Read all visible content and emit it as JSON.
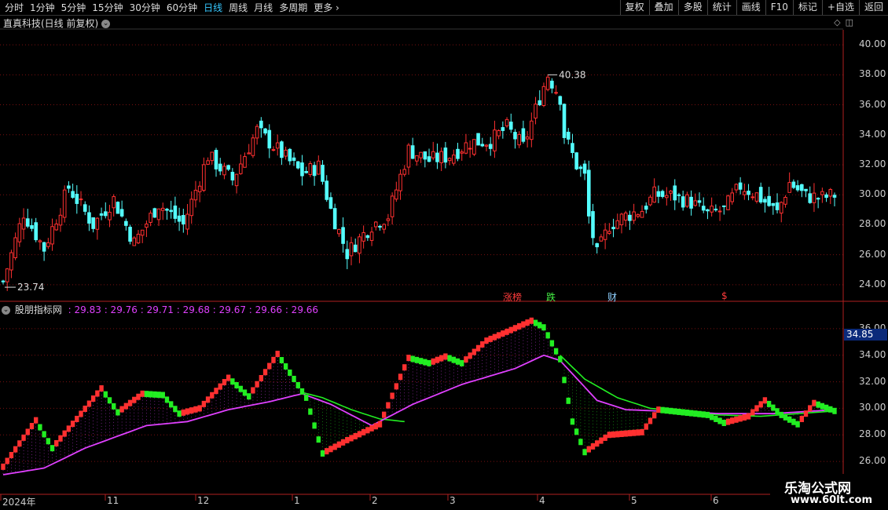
{
  "toolbar": {
    "tabs": [
      "分时",
      "1分钟",
      "5分钟",
      "15分钟",
      "30分钟",
      "60分钟",
      "日线",
      "周线",
      "月线",
      "多周期",
      "更多"
    ],
    "active": "日线",
    "right_buttons": [
      "复权",
      "叠加",
      "多股",
      "统计",
      "画线",
      "F10",
      "标记",
      "+自选",
      "返回"
    ]
  },
  "main": {
    "title": "直真科技(日线 前复权)",
    "max_label": "40.38",
    "min_label": "23.74",
    "y_ticks": [
      "40.00",
      "38.00",
      "36.00",
      "34.00",
      "32.00",
      "30.00",
      "28.00",
      "26.00",
      "24.00"
    ],
    "markers": [
      {
        "text": "涨榜",
        "color": "#ff3b3b"
      },
      {
        "text": "跌",
        "color": "#44ee44"
      },
      {
        "text": "财",
        "color": "#8fd0ff"
      },
      {
        "text": "$",
        "color": "#ff3b3b"
      }
    ]
  },
  "indicator": {
    "name": "股朋指标网",
    "values": ": 29.83 : 29.76 : 29.71 : 29.68 : 29.67 : 29.66 : 29.66",
    "y_ticks": [
      "36.00",
      "34.00",
      "32.00",
      "30.00",
      "28.00",
      "26.00"
    ],
    "current": "34.85"
  },
  "x_axis": [
    "2024年",
    "11",
    "12",
    "1",
    "2",
    "3",
    "4",
    "5",
    "6"
  ],
  "watermark": {
    "line1": "乐淘公式网",
    "line2": "www.60lt.com"
  },
  "colors": {
    "up": "#ff3030",
    "down": "#54ffff",
    "grid": "#7a1010",
    "axis": "#b02020",
    "green": "#22ee22",
    "magenta": "#e040ff"
  },
  "chart_data": {
    "type": "candlestick",
    "main_ylim": [
      23,
      41
    ],
    "indicator_ylim": [
      25,
      37
    ],
    "price_path": [
      [
        0,
        24.2
      ],
      [
        5,
        28.8
      ],
      [
        10,
        26.4
      ],
      [
        16,
        30.5
      ],
      [
        22,
        28.0
      ],
      [
        27,
        29.7
      ],
      [
        32,
        26.8
      ],
      [
        38,
        29.4
      ],
      [
        44,
        28.0
      ],
      [
        50,
        32.6
      ],
      [
        56,
        31.0
      ],
      [
        62,
        34.3
      ],
      [
        67,
        33.0
      ],
      [
        73,
        31.4
      ],
      [
        77,
        31.9
      ],
      [
        80,
        29.0
      ],
      [
        84,
        26.1
      ],
      [
        90,
        28.0
      ],
      [
        94,
        28.6
      ],
      [
        99,
        33.0
      ],
      [
        104,
        32.3
      ],
      [
        109,
        32.6
      ],
      [
        114,
        33.5
      ],
      [
        119,
        33.6
      ],
      [
        123,
        34.5
      ],
      [
        127,
        33.2
      ],
      [
        131,
        36.5
      ],
      [
        133,
        38.0
      ],
      [
        136,
        36.5
      ],
      [
        137,
        34.0
      ],
      [
        140,
        32.0
      ],
      [
        142,
        31.2
      ],
      [
        143,
        28.5
      ],
      [
        145,
        26.0
      ],
      [
        148,
        28.0
      ],
      [
        152,
        28.6
      ],
      [
        156,
        29.0
      ],
      [
        159,
        30.0
      ],
      [
        164,
        29.9
      ],
      [
        168,
        29.5
      ],
      [
        172,
        28.7
      ],
      [
        176,
        29.0
      ],
      [
        180,
        30.6
      ],
      [
        184,
        30.0
      ],
      [
        187,
        29.3
      ],
      [
        189,
        28.8
      ],
      [
        192,
        30.8
      ],
      [
        196,
        29.9
      ],
      [
        200,
        29.8
      ],
      [
        203,
        30.0
      ]
    ],
    "indicator_path": [
      [
        0,
        25.6
      ],
      [
        8,
        29.1
      ],
      [
        12,
        27.0
      ],
      [
        18,
        29.2
      ],
      [
        24,
        31.5
      ],
      [
        28,
        29.7
      ],
      [
        34,
        31.1
      ],
      [
        39,
        31.0
      ],
      [
        43,
        29.6
      ],
      [
        48,
        30.0
      ],
      [
        55,
        32.3
      ],
      [
        60,
        30.9
      ],
      [
        67,
        34.1
      ],
      [
        74,
        30.8
      ],
      [
        78,
        26.6
      ],
      [
        84,
        27.6
      ],
      [
        92,
        28.8
      ],
      [
        99,
        33.8
      ],
      [
        104,
        33.4
      ],
      [
        108,
        33.9
      ],
      [
        112,
        33.4
      ],
      [
        118,
        35.1
      ],
      [
        124,
        35.9
      ],
      [
        129,
        36.6
      ],
      [
        132,
        36.1
      ],
      [
        136,
        33.7
      ],
      [
        139,
        29.0
      ],
      [
        142,
        26.7
      ],
      [
        148,
        28.0
      ],
      [
        152,
        28.1
      ],
      [
        156,
        28.2
      ],
      [
        160,
        29.9
      ],
      [
        166,
        29.7
      ],
      [
        172,
        29.5
      ],
      [
        176,
        28.9
      ],
      [
        182,
        29.4
      ],
      [
        186,
        30.6
      ],
      [
        190,
        29.5
      ],
      [
        194,
        28.8
      ],
      [
        198,
        30.4
      ],
      [
        203,
        29.8
      ]
    ],
    "ma_path": [
      [
        0,
        25.0
      ],
      [
        10,
        25.5
      ],
      [
        20,
        27.0
      ],
      [
        35,
        28.7
      ],
      [
        45,
        29.0
      ],
      [
        55,
        29.9
      ],
      [
        65,
        30.5
      ],
      [
        73,
        31.1
      ],
      [
        80,
        30.3
      ],
      [
        90,
        28.7
      ],
      [
        100,
        30.3
      ],
      [
        112,
        31.8
      ],
      [
        125,
        33.0
      ],
      [
        132,
        34.0
      ],
      [
        136,
        33.6
      ],
      [
        145,
        30.6
      ],
      [
        152,
        29.9
      ],
      [
        160,
        29.8
      ],
      [
        175,
        29.6
      ],
      [
        188,
        29.6
      ],
      [
        203,
        29.9
      ]
    ],
    "green_line_path": [
      [
        73,
        31.2
      ],
      [
        78,
        30.8
      ],
      [
        85,
        29.9
      ],
      [
        92,
        29.2
      ],
      [
        98,
        29.0
      ],
      [
        136,
        34.0
      ],
      [
        142,
        32.2
      ],
      [
        150,
        30.8
      ],
      [
        158,
        30.0
      ],
      [
        165,
        29.8
      ],
      [
        175,
        29.5
      ],
      [
        185,
        29.4
      ],
      [
        203,
        29.8
      ]
    ]
  }
}
